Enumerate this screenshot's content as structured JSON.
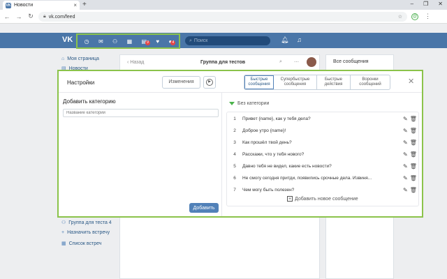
{
  "browser": {
    "tab_title": "Новости",
    "url": "vk.com/feed"
  },
  "vk": {
    "search_placeholder": "Поиск",
    "badges": [
      "9",
      "4"
    ]
  },
  "sidebar": {
    "items_top": [
      "Моя страница",
      "Новости"
    ],
    "items_bottom": [
      "Группа для теста 4",
      "Назначить встречу",
      "Список встреч"
    ]
  },
  "chat": {
    "back": "Назад",
    "title": "Группа для тестов"
  },
  "right_panel": {
    "all_messages": "Все сообщения"
  },
  "modal": {
    "title": "Настройки",
    "changes_button": "Изменения",
    "segments": [
      "Быстрые сообщения",
      "Супербыстрые сообщения",
      "Быстрые действия",
      "Воронки сообщений"
    ],
    "left": {
      "title": "Добавить категорию",
      "placeholder": "Название категории",
      "add_button": "Добавить"
    },
    "category": "Без категории",
    "messages": [
      "Привет {name}, как у тебя дела?",
      "Доброе утро {name}!",
      "Как прошёл твой день?",
      "Расскажи, что у тебя нового?",
      "Давно тебя не видел, какие есть новости?",
      "Не смогу сегодня притди, появились срочные дела. Извиня...",
      "Чем могу быть полезен?"
    ],
    "add_message": "Добавить новое сообщение"
  }
}
